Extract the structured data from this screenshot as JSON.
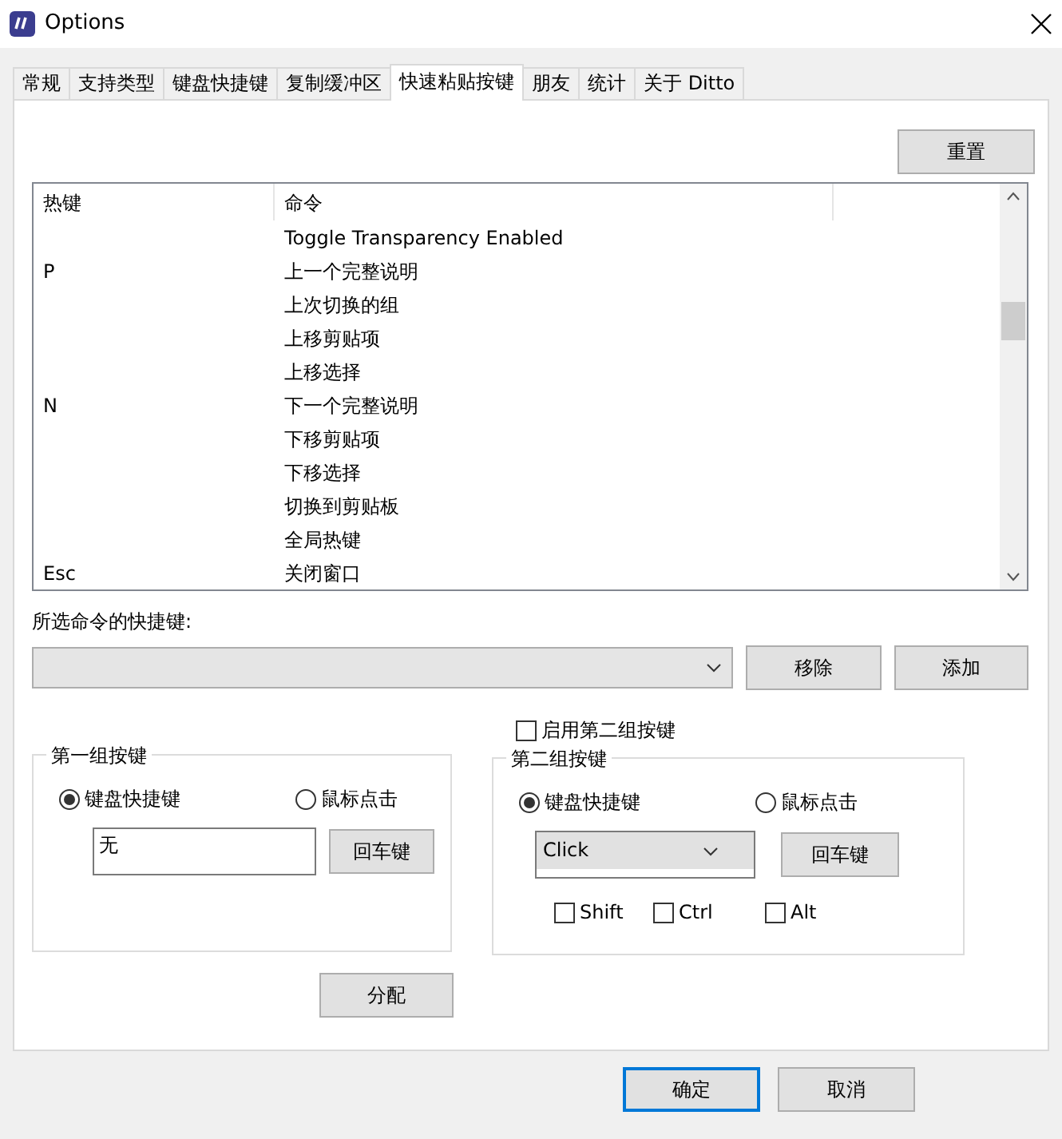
{
  "window": {
    "title": "Options"
  },
  "tabs": [
    {
      "label": "常规",
      "selected": false
    },
    {
      "label": "支持类型",
      "selected": false
    },
    {
      "label": "键盘快捷键",
      "selected": false
    },
    {
      "label": "复制缓冲区",
      "selected": false
    },
    {
      "label": "快速粘贴按键",
      "selected": true
    },
    {
      "label": "朋友",
      "selected": false
    },
    {
      "label": "统计",
      "selected": false
    },
    {
      "label": "关于 Ditto",
      "selected": false
    }
  ],
  "reset_button": "重置",
  "table": {
    "columns": [
      "热键",
      "命令"
    ],
    "rows": [
      {
        "hotkey": "",
        "command": "Toggle Transparency Enabled"
      },
      {
        "hotkey": "P",
        "command": "上一个完整说明"
      },
      {
        "hotkey": "",
        "command": "上次切换的组"
      },
      {
        "hotkey": "",
        "command": "上移剪贴项"
      },
      {
        "hotkey": "",
        "command": "上移选择"
      },
      {
        "hotkey": "N",
        "command": "下一个完整说明"
      },
      {
        "hotkey": "",
        "command": "下移剪贴项"
      },
      {
        "hotkey": "",
        "command": "下移选择"
      },
      {
        "hotkey": "",
        "command": "切换到剪贴板"
      },
      {
        "hotkey": "",
        "command": "全局热键"
      },
      {
        "hotkey": "Esc",
        "command": "关闭窗口"
      }
    ]
  },
  "selected_shortcut_label": "所选命令的快捷键:",
  "remove_button": "移除",
  "add_button": "添加",
  "enable_second": {
    "label": "启用第二组按键",
    "checked": false
  },
  "groups": [
    {
      "title": "第一组按键",
      "radios": [
        {
          "label": "键盘快捷键",
          "selected": true
        },
        {
          "label": "鼠标点击",
          "selected": false
        }
      ],
      "kind": "text",
      "value": "无",
      "enter_button": "回车键"
    },
    {
      "title": "第二组按键",
      "radios": [
        {
          "label": "键盘快捷键",
          "selected": true
        },
        {
          "label": "鼠标点击",
          "selected": false
        }
      ],
      "kind": "combo",
      "value": "Click",
      "enter_button": "回车键",
      "modifiers": [
        {
          "label": "Shift",
          "checked": false
        },
        {
          "label": "Ctrl",
          "checked": false
        },
        {
          "label": "Alt",
          "checked": false
        }
      ]
    }
  ],
  "assign_button": "分配",
  "ok_button": "确定",
  "cancel_button": "取消"
}
